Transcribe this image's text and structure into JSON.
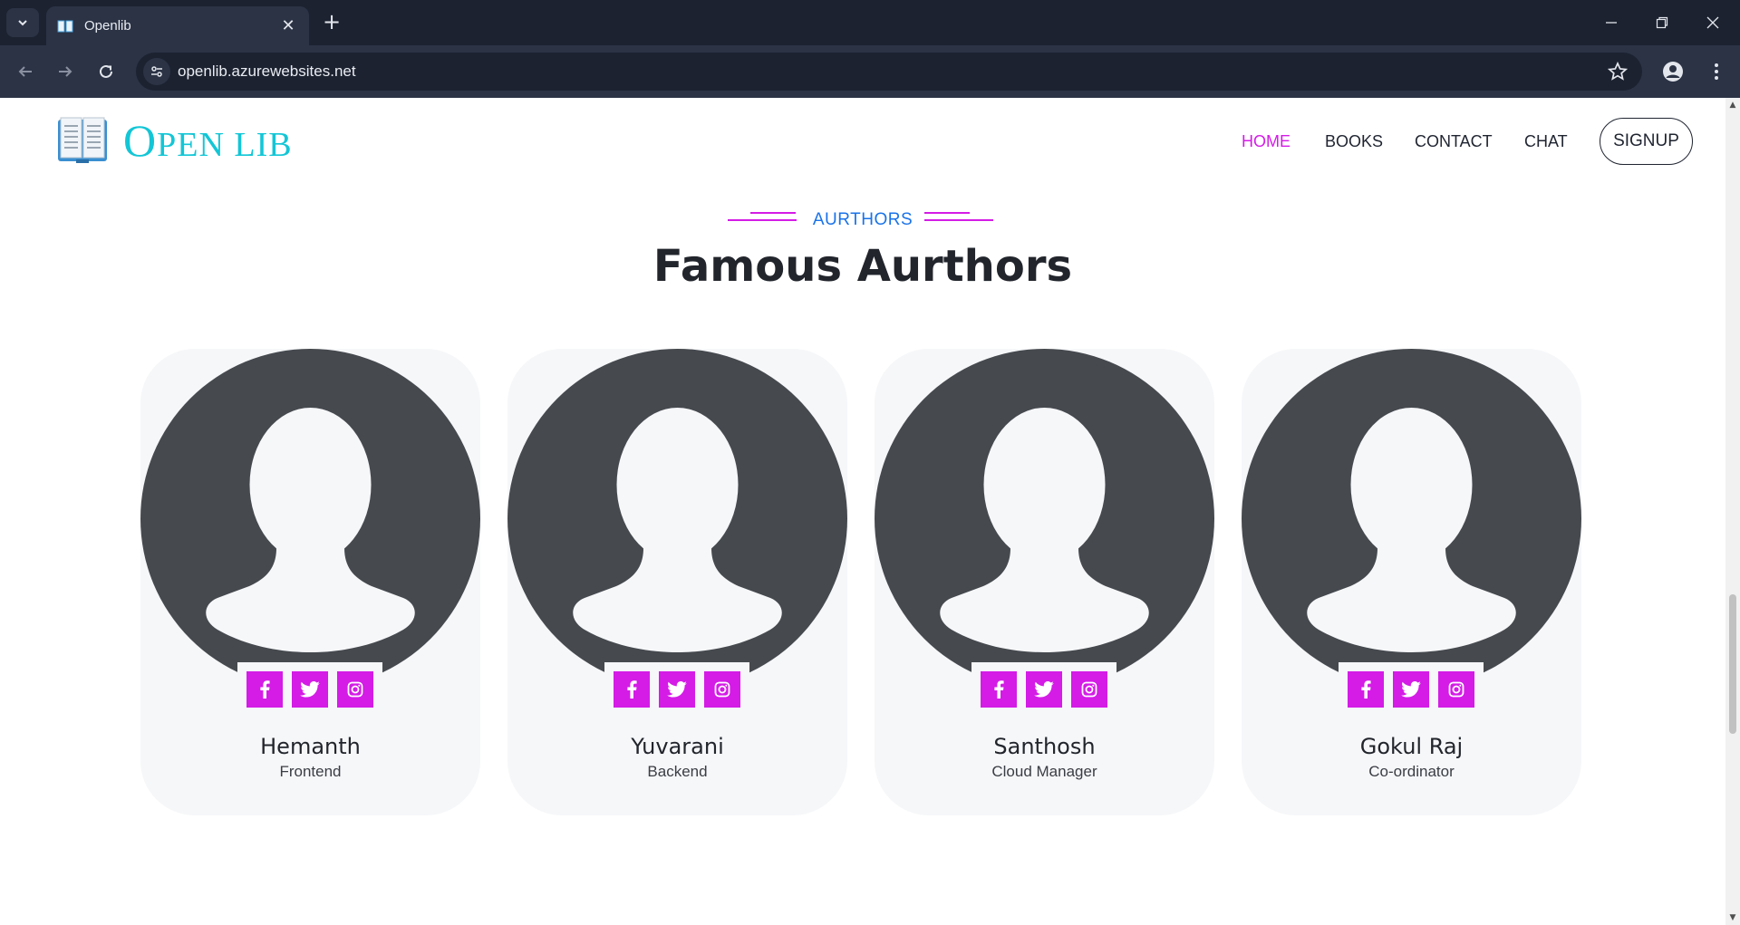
{
  "browser": {
    "tab_title": "Openlib",
    "url": "openlib.azurewebsites.net"
  },
  "site": {
    "brand_first": "O",
    "brand_rest": "PEN LIB",
    "nav": [
      {
        "label": "HOME",
        "active": true
      },
      {
        "label": "BOOKS",
        "active": false
      },
      {
        "label": "CONTACT",
        "active": false
      },
      {
        "label": "CHAT",
        "active": false
      }
    ],
    "signup_label": "SIGNUP"
  },
  "section": {
    "eyebrow": "AURTHORS",
    "heading": "Famous Aurthors"
  },
  "authors": [
    {
      "name": "Hemanth",
      "role": "Frontend"
    },
    {
      "name": "Yuvarani",
      "role": "Backend"
    },
    {
      "name": "Santhosh",
      "role": "Cloud Manager"
    },
    {
      "name": "Gokul Raj",
      "role": "Co-ordinator"
    }
  ],
  "colors": {
    "accent": "#d41ce6",
    "brand": "#13c6d6",
    "eyebrow": "#1a73e8",
    "avatar_bg": "#464a4f"
  }
}
